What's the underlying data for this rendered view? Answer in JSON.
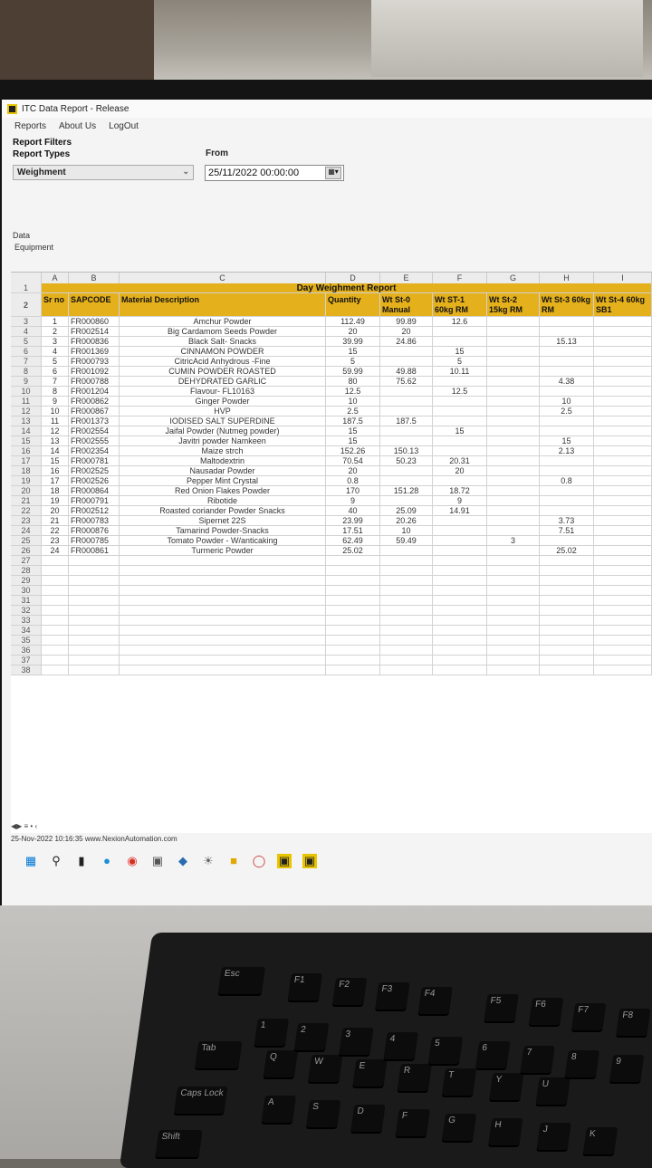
{
  "window": {
    "title": "ITC Data Report - Release",
    "menu": [
      "Reports",
      "About Us",
      "LogOut"
    ]
  },
  "filters": {
    "section_title": "Report Filters",
    "report_types_label": "Report Types",
    "report_type_value": "Weighment",
    "from_label": "From",
    "from_value": "25/11/2022 00:00:00",
    "data_label": "Data",
    "equipment_label": "Equipment"
  },
  "sheet": {
    "columns": [
      "A",
      "B",
      "C",
      "D",
      "E",
      "F",
      "G",
      "H",
      "I"
    ],
    "title": "Day Weighment Report",
    "headers": [
      "Sr no",
      "SAPCODE",
      "Material Description",
      "Quantity",
      "Wt St-0 Manual",
      "Wt ST-1 60kg RM",
      "Wt St-2 15kg RM",
      "Wt St-3 60kg RM",
      "Wt St-4 60kg SB1"
    ],
    "rows": [
      [
        "1",
        "FR000860",
        "Amchur Powder",
        "112.49",
        "99.89",
        "12.6",
        "",
        "",
        ""
      ],
      [
        "2",
        "FR002514",
        "Big Cardamom Seeds Powder",
        "20",
        "20",
        "",
        "",
        "",
        ""
      ],
      [
        "3",
        "FR000836",
        "Black Salt- Snacks",
        "39.99",
        "24.86",
        "",
        "",
        "15.13",
        ""
      ],
      [
        "4",
        "FR001369",
        "CINNAMON POWDER",
        "15",
        "",
        "15",
        "",
        "",
        ""
      ],
      [
        "5",
        "FR000793",
        "CitricAcid Anhydrous -Fine",
        "5",
        "",
        "5",
        "",
        "",
        ""
      ],
      [
        "6",
        "FR001092",
        "CUMIN POWDER ROASTED",
        "59.99",
        "49.88",
        "10.11",
        "",
        "",
        ""
      ],
      [
        "7",
        "FR000788",
        "DEHYDRATED GARLIC",
        "80",
        "75.62",
        "",
        "",
        "4.38",
        ""
      ],
      [
        "8",
        "FR001204",
        "Flavour- FL10163",
        "12.5",
        "",
        "12.5",
        "",
        "",
        ""
      ],
      [
        "9",
        "FR000862",
        "Ginger Powder",
        "10",
        "",
        "",
        "",
        "10",
        ""
      ],
      [
        "10",
        "FR000867",
        "HVP",
        "2.5",
        "",
        "",
        "",
        "2.5",
        ""
      ],
      [
        "11",
        "FR001373",
        "IODISED SALT SUPERDINE",
        "187.5",
        "187.5",
        "",
        "",
        "",
        ""
      ],
      [
        "12",
        "FR002554",
        "Jaifal Powder (Nutmeg powder)",
        "15",
        "",
        "15",
        "",
        "",
        ""
      ],
      [
        "13",
        "FR002555",
        "Javitri powder Namkeen",
        "15",
        "",
        "",
        "",
        "15",
        ""
      ],
      [
        "14",
        "FR002354",
        "Maize strch",
        "152.26",
        "150.13",
        "",
        "",
        "2.13",
        ""
      ],
      [
        "15",
        "FR000781",
        "Maltodextrin",
        "70.54",
        "50.23",
        "20.31",
        "",
        "",
        ""
      ],
      [
        "16",
        "FR002525",
        "Nausadar Powder",
        "20",
        "",
        "20",
        "",
        "",
        ""
      ],
      [
        "17",
        "FR002526",
        "Pepper Mint Crystal",
        "0.8",
        "",
        "",
        "",
        "0.8",
        ""
      ],
      [
        "18",
        "FR000864",
        "Red Onion Flakes Powder",
        "170",
        "151.28",
        "18.72",
        "",
        "",
        ""
      ],
      [
        "19",
        "FR000791",
        "Ribotide",
        "9",
        "",
        "9",
        "",
        "",
        ""
      ],
      [
        "20",
        "FR002512",
        "Roasted coriander Powder Snacks",
        "40",
        "25.09",
        "14.91",
        "",
        "",
        ""
      ],
      [
        "21",
        "FR000783",
        "Sipernet 22S",
        "23.99",
        "20.26",
        "",
        "",
        "3.73",
        ""
      ],
      [
        "22",
        "FR000876",
        "Tamarind Powder-Snacks",
        "17.51",
        "10",
        "",
        "",
        "7.51",
        ""
      ],
      [
        "23",
        "FR000785",
        "Tomato Powder - W/anticaking",
        "62.49",
        "59.49",
        "",
        "3",
        "",
        ""
      ],
      [
        "24",
        "FR000861",
        "Turmeric Powder",
        "25.02",
        "",
        "",
        "",
        "25.02",
        ""
      ]
    ],
    "extra_row_numbers": [
      "27",
      "28",
      "29",
      "30",
      "31",
      "32",
      "33",
      "34",
      "35",
      "36",
      "37",
      "38"
    ]
  },
  "status": {
    "datetime": "25-Nov-2022 10:16:35",
    "site": "www.NexionAutomation.com"
  },
  "keyboard": {
    "keys": [
      "Esc",
      "F1",
      "F2",
      "F3",
      "F4",
      "F5",
      "F6",
      "F7",
      "F8",
      "Tab",
      "Caps Lock",
      "Shift",
      "Q",
      "W",
      "E",
      "R",
      "T",
      "Y",
      "U",
      "A",
      "S",
      "D",
      "F",
      "G",
      "H",
      "J",
      "K",
      "1",
      "2",
      "3",
      "4",
      "5",
      "6",
      "7",
      "8",
      "9"
    ]
  }
}
